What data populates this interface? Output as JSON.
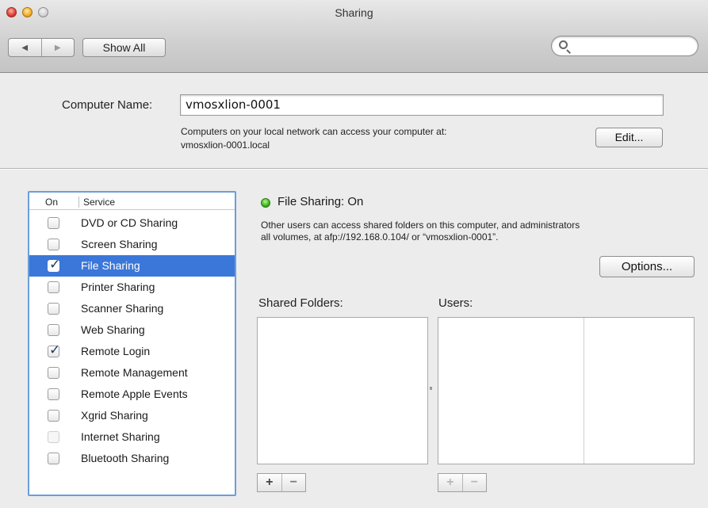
{
  "window": {
    "title": "Sharing"
  },
  "toolbar": {
    "back_icon": "◀",
    "forward_icon": "▶",
    "show_all_label": "Show All",
    "search_placeholder": ""
  },
  "computer_name": {
    "label": "Computer Name:",
    "value": "vmosxlion-0001",
    "access_line1": "Computers on your local network can access your computer at:",
    "access_line2": "vmosxlion-0001.local",
    "edit_label": "Edit..."
  },
  "service_list": {
    "header_on": "On",
    "header_service": "Service",
    "items": [
      {
        "label": "DVD or CD Sharing",
        "checked": false,
        "selected": false,
        "enabled": true
      },
      {
        "label": "Screen Sharing",
        "checked": false,
        "selected": false,
        "enabled": true
      },
      {
        "label": "File Sharing",
        "checked": true,
        "selected": true,
        "enabled": true
      },
      {
        "label": "Printer Sharing",
        "checked": false,
        "selected": false,
        "enabled": true
      },
      {
        "label": "Scanner Sharing",
        "checked": false,
        "selected": false,
        "enabled": true
      },
      {
        "label": "Web Sharing",
        "checked": false,
        "selected": false,
        "enabled": true
      },
      {
        "label": "Remote Login",
        "checked": true,
        "selected": false,
        "enabled": true
      },
      {
        "label": "Remote Management",
        "checked": false,
        "selected": false,
        "enabled": true
      },
      {
        "label": "Remote Apple Events",
        "checked": false,
        "selected": false,
        "enabled": true
      },
      {
        "label": "Xgrid Sharing",
        "checked": false,
        "selected": false,
        "enabled": true
      },
      {
        "label": "Internet Sharing",
        "checked": false,
        "selected": false,
        "enabled": false
      },
      {
        "label": "Bluetooth Sharing",
        "checked": false,
        "selected": false,
        "enabled": true
      }
    ]
  },
  "detail": {
    "status_title": "File Sharing: On",
    "status_color": "#3cb21e",
    "desc_line1": "Other users can access shared folders on this computer, and administrators",
    "desc_line2": "all volumes, at afp://192.168.0.104/ or “vmosxlion-0001”.",
    "options_label": "Options...",
    "shared_folders_label": "Shared Folders:",
    "users_label": "Users:",
    "add_label": "+",
    "remove_label": "−"
  },
  "colors": {
    "selection": "#3b77d8",
    "list_focus_ring": "#6a9edc"
  }
}
